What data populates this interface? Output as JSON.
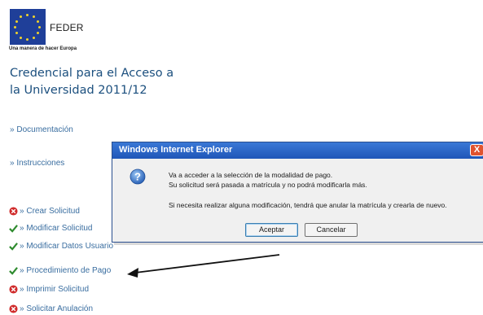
{
  "header": {
    "logo_text": "FEDER",
    "tagline": "Una manera de hacer Europa",
    "title_line1": "Credencial para el Acceso a",
    "title_line2": "la Universidad 2011/12"
  },
  "nav": {
    "prefix": "»",
    "links": [
      {
        "label": "Documentación"
      },
      {
        "label": "Instrucciones"
      }
    ],
    "actions": [
      {
        "label": "Crear Solicitud",
        "status": "error",
        "icon": "red-x-icon"
      },
      {
        "label": "Modificar Solicitud",
        "status": "ok",
        "icon": "green-check-icon"
      },
      {
        "label": "Modificar Datos Usuario",
        "status": "ok",
        "icon": "green-check-icon"
      },
      {
        "label": "Procedimiento de Pago",
        "status": "ok",
        "icon": "green-check-icon"
      },
      {
        "label": "Imprimir Solicitud",
        "status": "error",
        "icon": "red-x-icon"
      },
      {
        "label": "Solicitar Anulación",
        "status": "error",
        "icon": "red-x-icon"
      }
    ]
  },
  "dialog": {
    "title": "Windows Internet Explorer",
    "close_label": "X",
    "icon": "question-icon",
    "message_line1": "Va a acceder a la selección de la modalidad de pago.",
    "message_line2": "Su solicitud será pasada a matrícula y no podrá modificarla más.",
    "message_line3": "Si necesita realizar alguna modificación, tendrá que anular la matrícula y crearla de nuevo.",
    "ok_label": "Aceptar",
    "cancel_label": "Cancelar"
  },
  "colors": {
    "link": "#3a6ea0",
    "title": "#1b4f7e",
    "titlebar": "#2a63c4",
    "check": "#2e8b2e",
    "error": "#d02b2b"
  }
}
